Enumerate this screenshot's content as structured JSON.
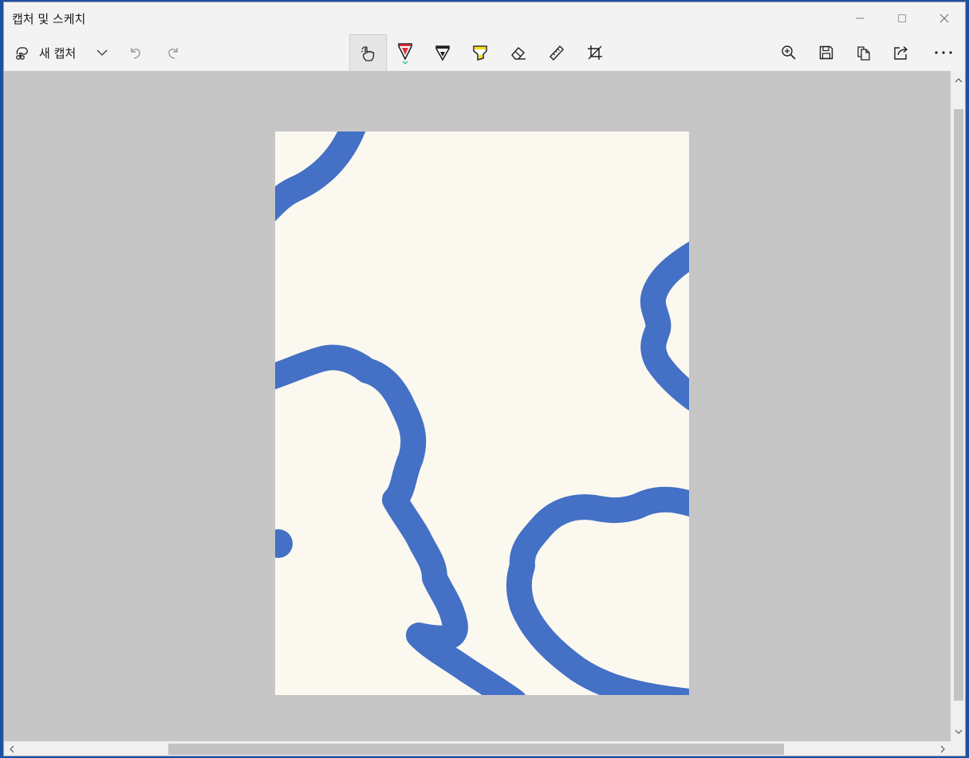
{
  "window": {
    "title": "캡처 및 스케치"
  },
  "toolbar": {
    "new_capture_label": "새 캡처",
    "left_icons": [
      "snip-icon",
      "chevron-down-icon",
      "undo-icon",
      "redo-icon"
    ],
    "tools": [
      "touch-writing-icon",
      "ballpoint-pen-icon",
      "pencil-icon",
      "highlighter-icon",
      "eraser-icon",
      "ruler-icon",
      "crop-icon"
    ],
    "active_tool": "ballpoint-pen-icon",
    "right_icons": [
      "zoom-in-icon",
      "save-icon",
      "copy-icon",
      "share-icon",
      "more-icon"
    ]
  },
  "colors": {
    "pen_red": "#e0303a",
    "highlighter_yellow": "#f4e21e",
    "active_indicator": "#2fbf71",
    "stroke_blue": "#4470c6",
    "paper": "#fbf8ef",
    "canvas_bg": "#c6c6c6"
  }
}
